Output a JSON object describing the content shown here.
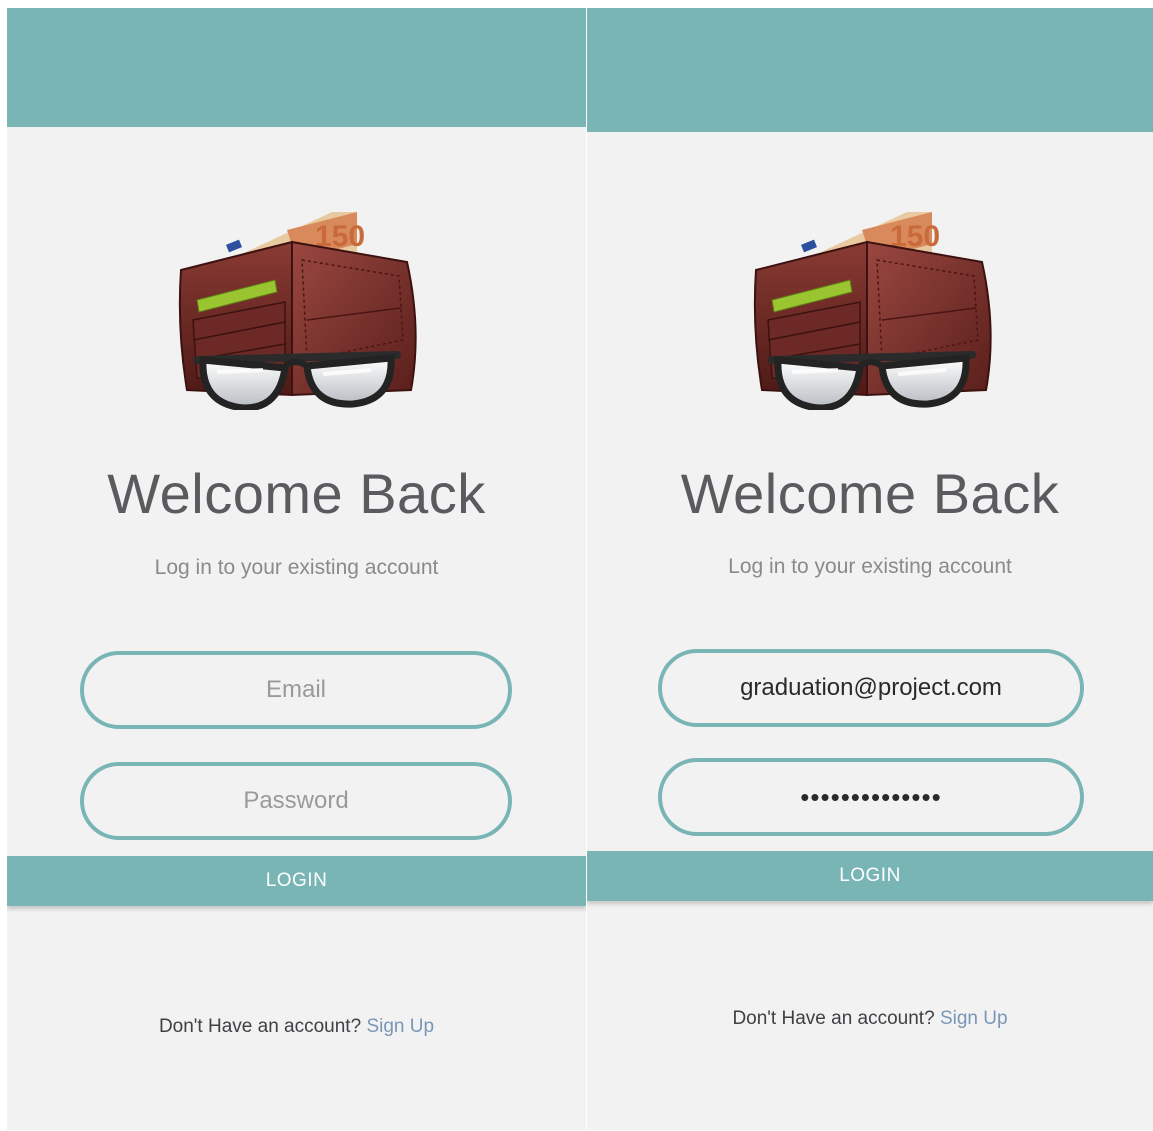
{
  "colors": {
    "accent": "#7ab5b6",
    "background": "#f2f2f2",
    "title_text": "#5a5a5f",
    "link": "#7a96b6"
  },
  "logo_icon": "wallet-with-glasses-icon",
  "left_screen": {
    "title": "Welcome Back",
    "subtitle": "Log in to your existing account",
    "email": {
      "placeholder": "Email",
      "value": ""
    },
    "password": {
      "placeholder": "Password",
      "value": ""
    },
    "login_label": "LOGIN",
    "signup_prompt": "Don't Have an account?",
    "signup_link": "Sign Up"
  },
  "right_screen": {
    "title": "Welcome Back",
    "subtitle": "Log in to your existing account",
    "email": {
      "placeholder": "Email",
      "value": "graduation@project.com"
    },
    "password": {
      "placeholder": "Password",
      "value": "••••••••••••••"
    },
    "login_label": "LOGIN",
    "signup_prompt": "Don't Have an account?",
    "signup_link": "Sign Up"
  }
}
